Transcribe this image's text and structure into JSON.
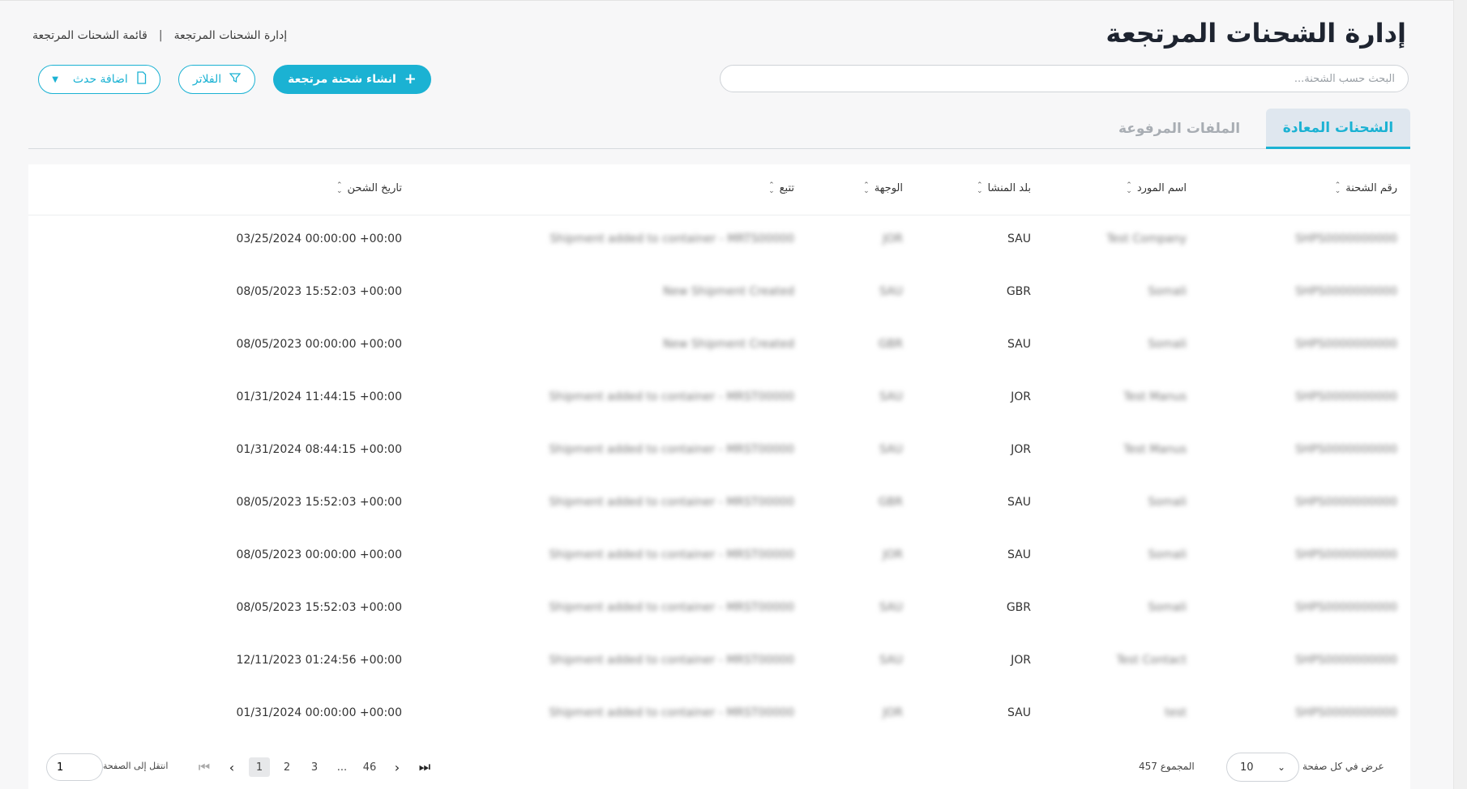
{
  "page": {
    "title": "إدارة الشحنات المرتجعة",
    "breadcrumb": [
      "إدارة الشحنات المرتجعة",
      "قائمة الشحنات المرتجعة"
    ]
  },
  "search": {
    "placeholder": "البحث حسب الشحنة..."
  },
  "actions": {
    "create": "انشاء شحنة مرتجعة",
    "filter": "الفلاتر",
    "add_event": "اضافة حدث"
  },
  "tabs": [
    {
      "label": "الشحنات المعادة",
      "active": true
    },
    {
      "label": "الملفات المرفوعة",
      "active": false
    }
  ],
  "table": {
    "columns": {
      "shipment_no": "رقم الشحنة",
      "supplier": "اسم المورد",
      "origin": "بلد المنشا",
      "destination": "الوجهة",
      "tracking": "تتبع",
      "date": "تاريخ الشحن"
    },
    "rows": [
      {
        "shipment_no": "SHPS0000000000",
        "supplier": "Test Company",
        "origin": "SAU",
        "destination": "JOR",
        "tracking": "Shipment added to container - MRTS00000",
        "date": "03/25/2024 00:00:00 +00:00"
      },
      {
        "shipment_no": "SHPS0000000000",
        "supplier": "Somali",
        "origin": "GBR",
        "destination": "SAU",
        "tracking": "New Shipment Created",
        "date": "08/05/2023 15:52:03 +00:00"
      },
      {
        "shipment_no": "SHPS0000000000",
        "supplier": "Somali",
        "origin": "SAU",
        "destination": "GBR",
        "tracking": "New Shipment Created",
        "date": "08/05/2023 00:00:00 +00:00"
      },
      {
        "shipment_no": "SHPS0000000000",
        "supplier": "Test Manus",
        "origin": "JOR",
        "destination": "SAU",
        "tracking": "Shipment added to container - MRST00000",
        "date": "01/31/2024 11:44:15 +00:00"
      },
      {
        "shipment_no": "SHPS0000000000",
        "supplier": "Test Manus",
        "origin": "JOR",
        "destination": "SAU",
        "tracking": "Shipment added to container - MRST00000",
        "date": "01/31/2024 08:44:15 +00:00"
      },
      {
        "shipment_no": "SHPS0000000000",
        "supplier": "Somali",
        "origin": "SAU",
        "destination": "GBR",
        "tracking": "Shipment added to container - MRST00000",
        "date": "08/05/2023 15:52:03 +00:00"
      },
      {
        "shipment_no": "SHPS0000000000",
        "supplier": "Somali",
        "origin": "SAU",
        "destination": "JOR",
        "tracking": "Shipment added to container - MRST00000",
        "date": "08/05/2023 00:00:00 +00:00"
      },
      {
        "shipment_no": "SHPS0000000000",
        "supplier": "Somali",
        "origin": "GBR",
        "destination": "SAU",
        "tracking": "Shipment added to container - MRST00000",
        "date": "08/05/2023 15:52:03 +00:00"
      },
      {
        "shipment_no": "SHPS0000000000",
        "supplier": "Test Contact",
        "origin": "JOR",
        "destination": "SAU",
        "tracking": "Shipment added to container - MRST00000",
        "date": "12/11/2023 01:24:56 +00:00"
      },
      {
        "shipment_no": "SHPS0000000000",
        "supplier": "test",
        "origin": "SAU",
        "destination": "JOR",
        "tracking": "Shipment added to container - MRST00000",
        "date": "01/31/2024 00:00:00 +00:00"
      }
    ]
  },
  "pagination": {
    "per_page_label": "عرض في كل صفحة",
    "per_page_value": "10",
    "total_label": "المجموع 457",
    "pages": [
      "1",
      "2",
      "3",
      "...",
      "46"
    ],
    "current_page": "1",
    "goto_label": "انتقل إلى الصفحة",
    "goto_value": "1"
  },
  "icons": {
    "plus": "plus-icon",
    "filter": "funnel-icon",
    "event": "document-icon",
    "dropdown": "caret-down-icon",
    "sort": "sort-icon",
    "first": "first-page-icon",
    "prev": "chevron-left-icon",
    "next": "chevron-right-icon",
    "last": "last-page-icon"
  },
  "colors": {
    "accent": "#1bb2d3",
    "background": "#f7f7f8",
    "tab_active_bg": "#dfe7ef"
  }
}
